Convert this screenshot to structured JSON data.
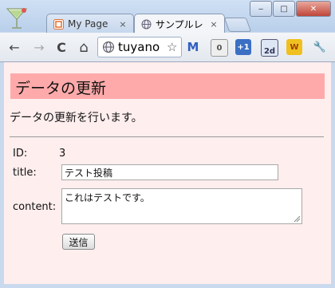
{
  "browser": {
    "tabs": [
      {
        "label": "My Page",
        "close": "×"
      },
      {
        "label": "サンプルレ",
        "close": "×"
      }
    ],
    "window_controls": {
      "minimize": "‒",
      "maximize": "□",
      "close": "✕"
    },
    "toolbar": {
      "back": "←",
      "forward": "→",
      "reload": "C",
      "home": "⌂",
      "url": "tuyano",
      "star": "☆",
      "ext_gmail": "M",
      "ext_count": "0",
      "ext_plus": "+1",
      "ext_calendar": "2d",
      "ext_w": "W",
      "wrench": "🔧"
    }
  },
  "page": {
    "heading": "データの更新",
    "description": "データの更新を行います。",
    "form": {
      "id_label": "ID:",
      "id_value": "3",
      "title_label": "title:",
      "title_value": "テスト投稿",
      "content_label": "content:",
      "content_value": "これはテストです。",
      "submit_label": "送信"
    }
  },
  "colors": {
    "header_bg": "#ffaaaa",
    "page_bg": "#ffeeee",
    "frame": "#c9d9ee"
  }
}
